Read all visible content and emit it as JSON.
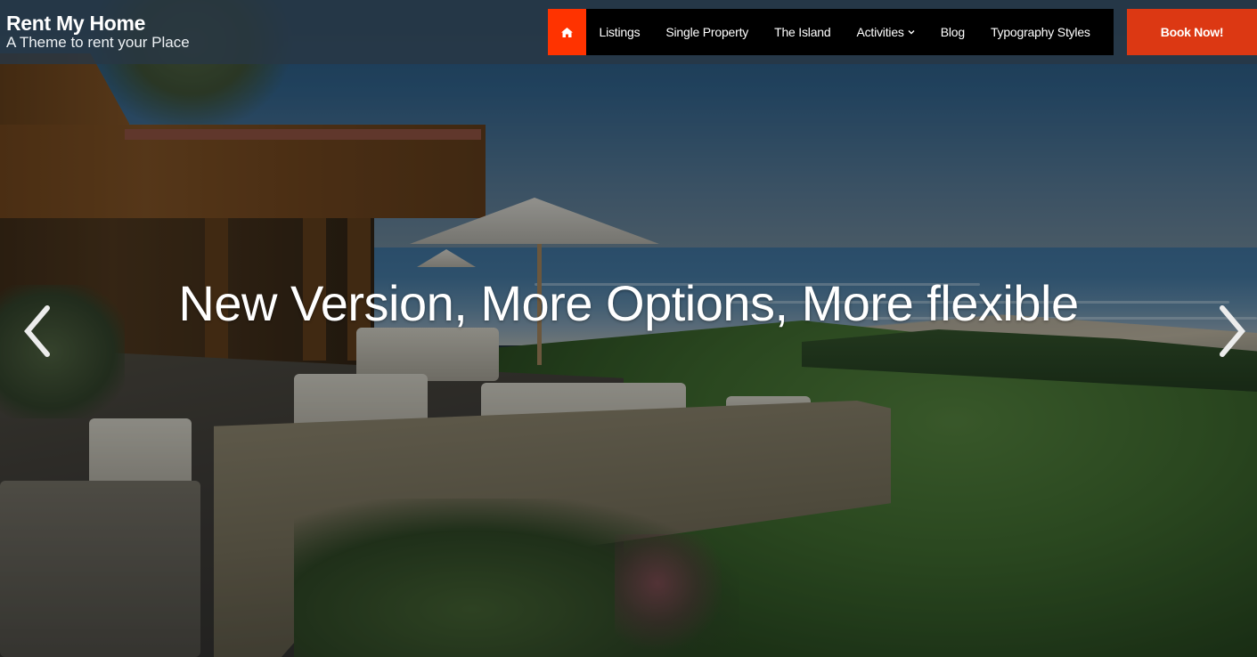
{
  "header": {
    "site_title": "Rent My Home",
    "tagline": "A Theme to rent your Place"
  },
  "nav": {
    "home_icon": "home-icon",
    "items": [
      {
        "label": "Listings"
      },
      {
        "label": "Single Property"
      },
      {
        "label": "The Island"
      },
      {
        "label": "Activities",
        "has_dropdown": true
      },
      {
        "label": "Blog"
      },
      {
        "label": "Typography Styles"
      }
    ],
    "cta_label": "Book Now!"
  },
  "slider": {
    "headline": "New Version, More Options, More flexible",
    "prev_icon": "chevron-left-icon",
    "next_icon": "chevron-right-icon",
    "image_description": "Beachfront house with patio, white outdoor sofas, umbrella, lawn and ocean view"
  },
  "colors": {
    "home_button": "#ff3300",
    "cta_button": "#dc3813",
    "nav_background": "#000000",
    "header_background": "#28374a"
  }
}
